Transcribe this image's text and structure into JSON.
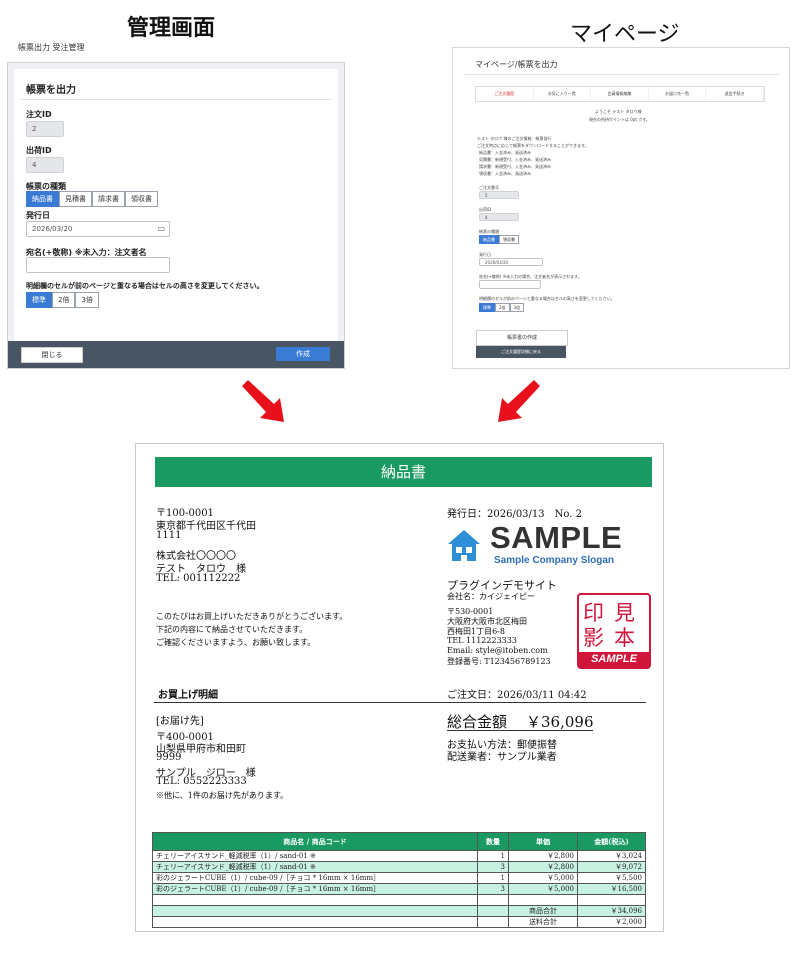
{
  "headings": {
    "admin": "管理画面",
    "mypage": "マイページ"
  },
  "admin": {
    "breadcrumb": "帳票出力 受注管理",
    "title": "帳票を出力",
    "order_id_label": "注文ID",
    "order_id_value": "2",
    "shipping_id_label": "出荷ID",
    "shipping_id_value": "4",
    "doc_type_label": "帳票の種類",
    "doc_types": [
      "納品書",
      "見積書",
      "請求書",
      "領収書"
    ],
    "issue_date_label": "発行日",
    "issue_date_value": "2026/03/20",
    "addressee_label": "宛名(+敬称) ※未入力：注文者名",
    "cell_label": "明細欄のセルが前のページと重なる場合はセルの高さを変更してください。",
    "cell_options": [
      "標準",
      "2倍",
      "3倍"
    ],
    "close_button": "閉じる",
    "create_button": "作成"
  },
  "mypage": {
    "title": "マイページ/帳票を出力",
    "tabs": [
      "ご注文履歴",
      "お気に入り一覧",
      "会員情報編集",
      "お届け先一覧",
      "退会手続き"
    ],
    "welcome_1": "ようこそ テスト タロウ様",
    "welcome_2": "現在の所持ポイントは 0pt です。",
    "notice_title": "テスト タロウ 様のご注文情報：帳票発行",
    "notice_body": "ご注文時点に応じて帳票をダウンロードすることができます。",
    "statuses": [
      "納品書：入金済み、発送済み",
      "見積書：新規受付、入金済み、発送済み",
      "請求書：新規受付、入金済み、発送済み",
      "領収書：入金済み、発送済み"
    ],
    "order_no_label": "ご注文番号",
    "order_no_value": "2",
    "shipping_id_label": "出荷ID",
    "shipping_id_value": "4",
    "doc_type_label": "帳票の種類",
    "doc_types": [
      "納品書",
      "領収書"
    ],
    "issue_date_label": "発行日",
    "issue_date_value": "2026/03/20",
    "addressee_label": "宛名(+敬称) ※未入力の場合、注文者名が表示されます。",
    "cell_label": "明細欄のセルが前のページと重なる場合はセルの高さを変更してください。",
    "cell_options": [
      "標準",
      "2倍",
      "3倍"
    ],
    "create_button": "帳票書の作成",
    "back_button": "ご注文履歴詳細に戻る"
  },
  "invoice": {
    "title": "納品書",
    "zip": "〒100-0001",
    "address_1": "東京都千代田区千代田",
    "address_2": "1111",
    "company": "株式会社〇〇〇〇",
    "customer": "テスト　タロウ　様",
    "tel": "TEL: 001112222",
    "thanks_1": "このたびはお買上げいただきありがとうございます。",
    "thanks_2": "下記の内容にて納品させていただきます。",
    "thanks_3": "ご確認くださいますよう、お願い致します。",
    "issue_line": "発行日：2026/03/13　No. 2",
    "logo_text": "SAMPLE",
    "logo_slogan": "Sample Company Slogan",
    "shop_name": "プラグインデモサイト",
    "shop_company": "会社名：カイジェイピー",
    "shop_zip": "〒530-0001",
    "shop_addr_1": "大阪府大阪市北区梅田",
    "shop_addr_2": "西梅田1丁目6-8",
    "shop_tel": "TEL 1112223333",
    "shop_email": "Email: style@itoben.com",
    "shop_reg": "登録番号: T123456789123",
    "seal_chars": [
      "印",
      "見",
      "影",
      "本"
    ],
    "seal_sample": "SAMPLE",
    "purchase_heading": "お買上げ明細",
    "order_date": "ご注文日：2026/03/11 04:42",
    "ship_to_heading": "[お届け先]",
    "ship_zip": "〒400-0001",
    "ship_addr_1": "山梨県甲府市和田町",
    "ship_addr_2": "9999",
    "ship_name": "サンプル　ジロー　様",
    "ship_tel": "TEL: 0552223333",
    "ship_note": "※他に、1件のお届け先があります。",
    "total_label": "総合金額",
    "total_value": "￥36,096",
    "payment": "お支払い方法：郵便振替",
    "carrier": "配送業者：サンプル業者",
    "table_headers": [
      "商品名 / 商品コード",
      "数量",
      "単価",
      "金額(税込)"
    ],
    "rows": [
      [
        "チェリーアイスサンド_軽減税率（1）/ sand-01 ※",
        "1",
        "￥2,800",
        "￥3,024"
      ],
      [
        "チェリーアイスサンド_軽減税率（1）/ sand-01 ※",
        "3",
        "￥2,800",
        "￥9,072"
      ],
      [
        "彩のジェラートCUBE（1）/ cube-09 /［チョコ * 16mm × 16mm］",
        "1",
        "￥5,000",
        "￥5,500"
      ],
      [
        "彩のジェラートCUBE（1）/ cube-09 /［チョコ * 16mm × 16mm］",
        "3",
        "￥5,000",
        "￥16,500"
      ]
    ],
    "subtotal_label": "商品合計",
    "subtotal_value": "￥34,096",
    "shipping_label": "送料合計",
    "shipping_value": "￥2,000"
  }
}
